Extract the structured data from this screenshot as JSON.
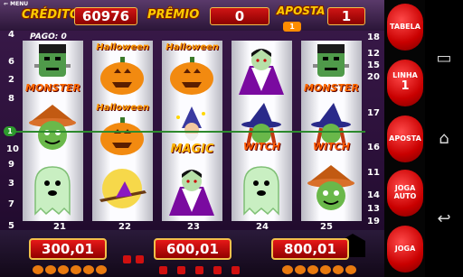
{
  "header": {
    "menu_label": "MENU",
    "credito_label": "CRÉDITO",
    "credito_value": "60976",
    "premio_label": "PRÊMIO",
    "premio_value": "0",
    "aposta_label": "APOSTA",
    "aposta_badge": "1",
    "aposta_value": "1"
  },
  "reels": {
    "pago_label": "PAGO: 0",
    "payline_badge": "1",
    "left_line_numbers": [
      "4",
      "6",
      "2",
      "8",
      "1",
      "10",
      "9",
      "3",
      "7",
      "5"
    ],
    "right_line_numbers": [
      "18",
      "12",
      "15",
      "20",
      "17",
      "16",
      "11",
      "14",
      "13",
      "19"
    ],
    "reel_numbers": [
      "21",
      "22",
      "23",
      "24",
      "25"
    ],
    "columns": [
      [
        {
          "symbol": "frankenstein",
          "caption": "MONSTER"
        },
        {
          "symbol": "scarecrow",
          "caption": ""
        },
        {
          "symbol": "ghost",
          "caption": ""
        }
      ],
      [
        {
          "symbol": "pumpkin",
          "caption": "Halloween"
        },
        {
          "symbol": "pumpkin",
          "caption": "Halloween"
        },
        {
          "symbol": "moon-witch",
          "caption": ""
        }
      ],
      [
        {
          "symbol": "pumpkin",
          "caption": "Halloween"
        },
        {
          "symbol": "wizard",
          "caption": "MAGIC"
        },
        {
          "symbol": "dracula",
          "caption": ""
        }
      ],
      [
        {
          "symbol": "dracula",
          "caption": ""
        },
        {
          "symbol": "witch",
          "caption": "WITCH"
        },
        {
          "symbol": "ghost",
          "caption": ""
        }
      ],
      [
        {
          "symbol": "frankenstein",
          "caption": "MONSTER"
        },
        {
          "symbol": "witch",
          "caption": "WITCH"
        },
        {
          "symbol": "scarecrow",
          "caption": ""
        }
      ]
    ]
  },
  "bets": [
    "300,01",
    "600,01",
    "800,01"
  ],
  "buttons": {
    "tabela": "TABELA",
    "linha": "LINHA",
    "linha_value": "1",
    "aposta": "APOSTA",
    "joga_auto_1": "JOGA",
    "joga_auto_2": "AUTO",
    "joga": "JOGA"
  },
  "colors": {
    "accent_red": "#d01515",
    "gold": "#ffcc00",
    "payline_green": "#2d8a2d"
  }
}
